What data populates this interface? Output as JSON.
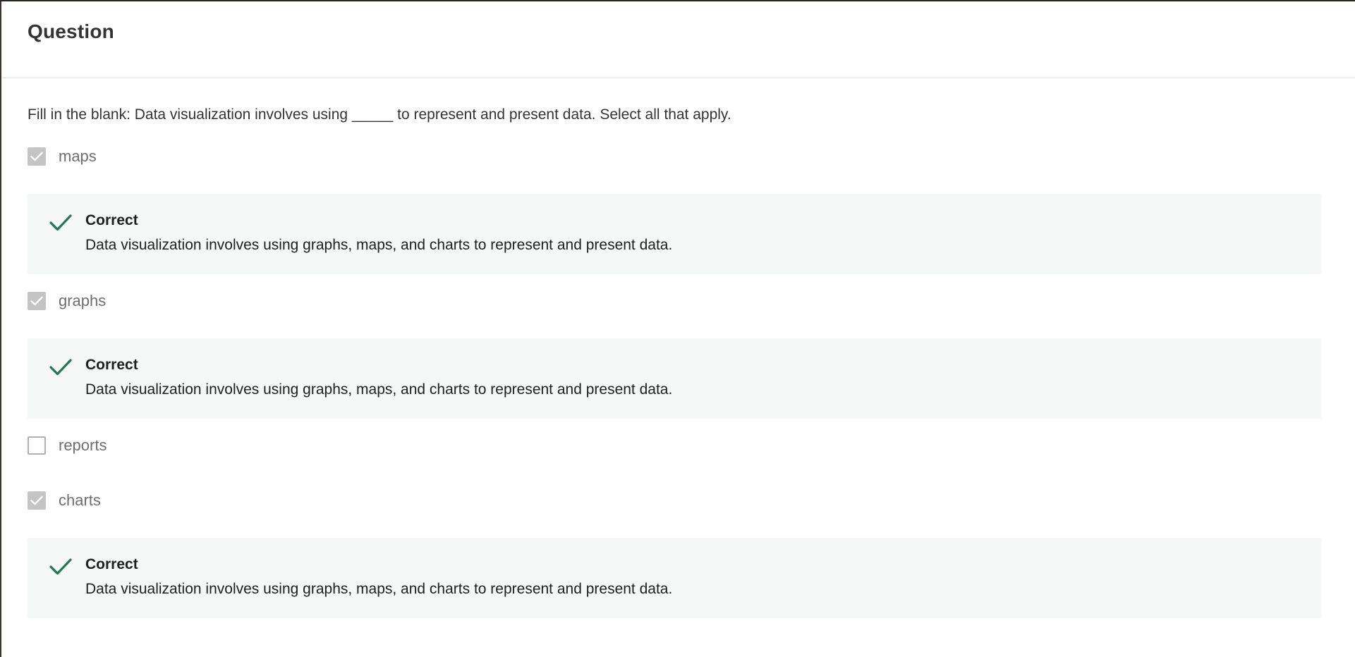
{
  "header": {
    "title": "Question"
  },
  "question": {
    "prompt": "Fill in the blank: Data visualization involves using _____ to represent and present data. Select all that apply."
  },
  "options": [
    {
      "label": "maps",
      "checked": true,
      "feedback": {
        "title": "Correct",
        "text": "Data visualization involves using graphs, maps, and charts to represent and present data."
      }
    },
    {
      "label": "graphs",
      "checked": true,
      "feedback": {
        "title": "Correct",
        "text": "Data visualization involves using graphs, maps, and charts to represent and present data."
      }
    },
    {
      "label": "reports",
      "checked": false
    },
    {
      "label": "charts",
      "checked": true,
      "feedback": {
        "title": "Correct",
        "text": "Data visualization involves using graphs, maps, and charts to represent and present data."
      }
    }
  ],
  "colors": {
    "correct_green": "#1f7a4d",
    "checkbox_checked": "#c4c4c4",
    "feedback_bg": "#f5f8f7"
  },
  "icons": {
    "checkbox_check": "checkmark-icon",
    "feedback_check": "checkmark-icon"
  }
}
